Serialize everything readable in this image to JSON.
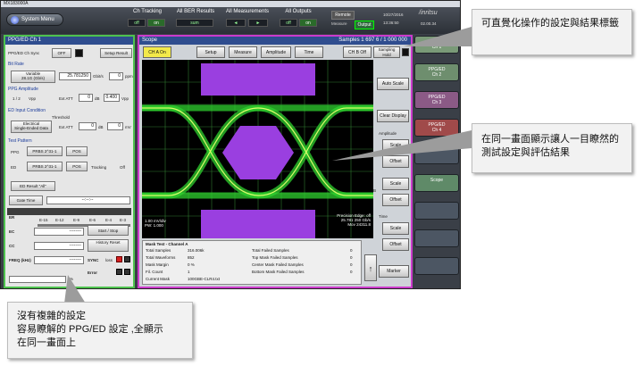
{
  "window": {
    "title": "MX183000A",
    "system_menu": "System Menu",
    "brand": "/inritsu",
    "date": "10/27/2016",
    "time": "13:36:50",
    "version": "02.00.34",
    "measure_status": "Output",
    "remote_label": "Remote",
    "measure_label": "Measure"
  },
  "toolbar": {
    "groups": [
      {
        "label": "Ch Tracking",
        "buttons": [
          "off",
          "on"
        ]
      },
      {
        "label": "All BER Results",
        "buttons": [
          "sum"
        ]
      },
      {
        "label": "All Measurements",
        "buttons": [
          "◄",
          "►"
        ]
      },
      {
        "label": "All Outputs",
        "buttons": [
          "off",
          "on"
        ]
      }
    ]
  },
  "left_panel": {
    "title": "PPG/ED Ch 1",
    "ppg_ed_ch_label": "PPG/ED Ch Sync",
    "ppg_ed_off": "OFF",
    "setup_result": "Setup Result",
    "bit_rate_section": "Bit Rate",
    "bit_rate_variable": "Variable",
    "bit_rate_variable2": "28.1G (Gb/s)",
    "bit_rate_value": "25.781250",
    "bit_rate_unit": "Gbit/s",
    "bit_rate_ppm": "0",
    "ppm": "ppm",
    "ppg_amp_section": "PPG Amplitude",
    "ppg_amp_label": "1 / 2",
    "ppg_vpp": "Vpp",
    "ext_att": "Ext ATT",
    "ppg_amp_value": "0",
    "db": "dB",
    "vpp_value": "0.400",
    "vpp_unit": "Vpp",
    "ed_input_section": "ED Input Condition",
    "threshold": "Threshold",
    "ed_mode1": "Electrical",
    "ed_mode2": "Single-Ended Data",
    "ed_ext_att": "Ext ATT",
    "ed_att_value": "0",
    "ed_db": "dB",
    "ed_threshold_value": "0",
    "mv": "mV",
    "test_pattern_section": "Test Pattern",
    "ppg_label": "PPG",
    "ppg_pattern": "PRBS 2^31-1",
    "ppg_pos": "POS",
    "ed_label": "ED",
    "ed_pattern": "PRBS 2^31-1",
    "ed_pos": "POS",
    "tracking": "Tracking",
    "tracking_value": "Off",
    "ed_result_btn": "ED Result \"All\"",
    "gate_time_btn": "Gate Time",
    "gate_time_value": "--:--:--",
    "er_label": "ER",
    "er_scale": [
      "E-15",
      "E-12",
      "E-9",
      "E-6",
      "E-4",
      "E-3"
    ],
    "ec_label": "EC",
    "ec_value": "--------",
    "start_stop": "Start / Stop",
    "cc_label": "CC",
    "cc_value": "--------",
    "history_reset": "History Reset",
    "freq_label": "FREQ (kHz)",
    "freq_value": "--------",
    "sync_label": "SYNC",
    "sync_loss": "loss",
    "error_label": "Error",
    "progress_label": "%",
    "progress_value": 0
  },
  "scope": {
    "title": "Scope",
    "samples": "Samples 1 697 6 / 1 000 000",
    "buttons": [
      "CH A On",
      "Setup",
      "Measure",
      "Amplitude",
      "Time",
      "CH B Off"
    ],
    "sampling_hold": "Sampling Hold",
    "auto_scale": "Auto Scale",
    "clear_display": "Clear Display",
    "amplitude_section": "Amplitude",
    "scale": "Scale",
    "offset": "Offset",
    "a_label": "A",
    "b_label": "B",
    "time_section": "Time",
    "marker": "Marker",
    "plot_left_readout": "1.00 mV/div\nPW: 1.000",
    "plot_right_readout": "Precision Edge: off\n25.781 250 Gb/s\nMov 24311.8",
    "stats": {
      "header": "Mask Test - Channel A",
      "rows": [
        [
          "Total Samples",
          "316.006k",
          "Total Failed Samples",
          "0"
        ],
        [
          "Total Waveforms",
          "852",
          "Top Mask Failed Samples",
          "0"
        ],
        [
          "Mask Margin",
          "0 %",
          "Center Mask Failed Samples",
          "0"
        ],
        [
          "Fil. Count",
          "1",
          "Bottom Mask Failed Samples",
          "0"
        ],
        [
          "Current Mask",
          "100GBE-CLR4.txt",
          "",
          ""
        ]
      ]
    }
  },
  "right_tabs": [
    {
      "label": "PPG/ED\nCh 1",
      "color": "#7a9a78"
    },
    {
      "label": "PPG/ED\nCh 2",
      "color": "#6e8e6e"
    },
    {
      "label": "PPG/ED\nCh 3",
      "color": "#8b5a86"
    },
    {
      "label": "PPG/ED\nCh 4",
      "color": "#a04a4a"
    },
    {
      "label": "",
      "color": "#4c5663"
    },
    {
      "label": "Scope",
      "color": "#5f8a68"
    },
    {
      "label": "",
      "color": "#4c5663"
    },
    {
      "label": "",
      "color": "#4c5663"
    },
    {
      "label": "",
      "color": "#4c5663"
    }
  ],
  "callouts": {
    "top_right": "可直覺化操作的設定與結果標籤",
    "middle_right": "在同一畫面顯示讓人一目瞭然的測試設定與評估結果",
    "bottom_left": "沒有複雜的設定\n容易瞭解的 PPG/ED 設定 ,全顯示\n在同一畫面上"
  },
  "colors": {
    "ppg_panel_border": "#4ec24e",
    "scope_border": "#cc3bcc",
    "mask": "#9a3fe0",
    "eye_trace": "#2fd12f"
  }
}
